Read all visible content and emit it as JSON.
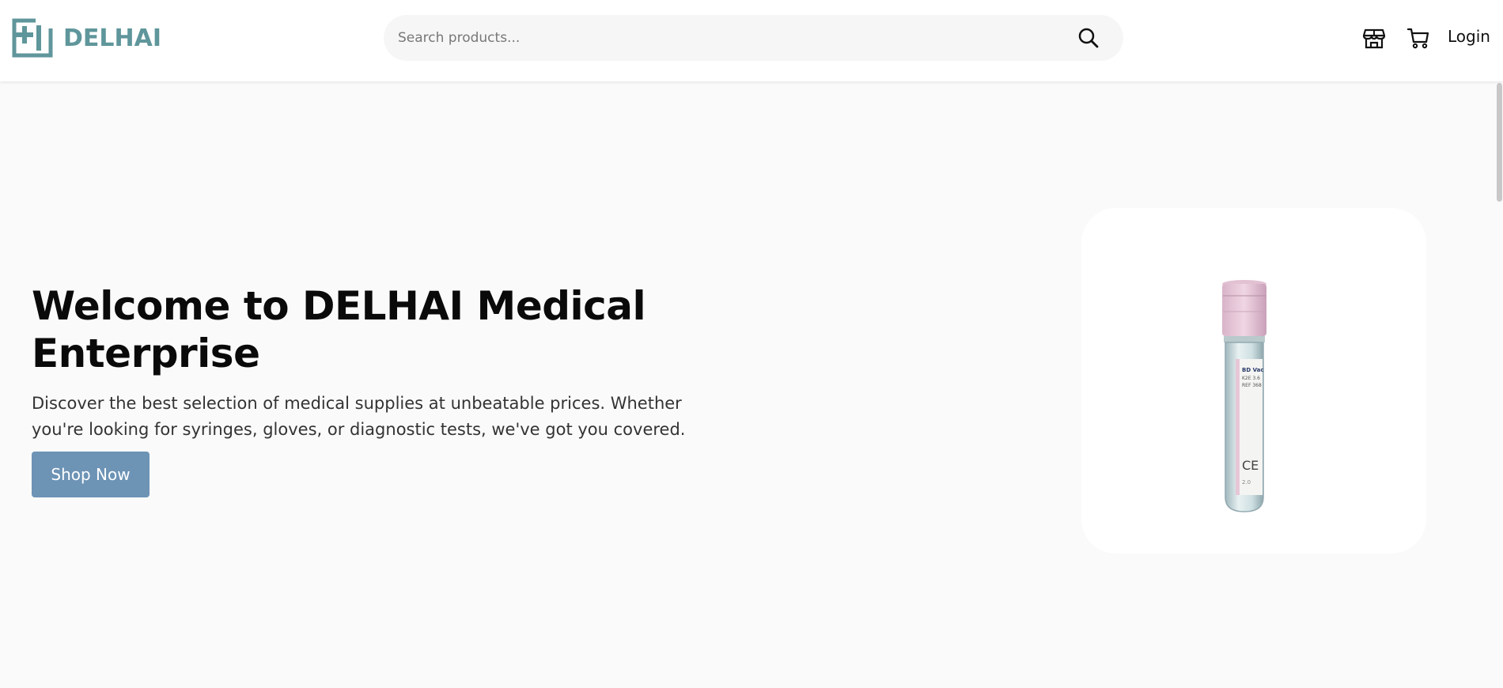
{
  "header": {
    "brand": "DELHAI",
    "search": {
      "placeholder": "Search products...",
      "value": ""
    },
    "icons": [
      "store-icon",
      "cart-icon",
      "search-icon"
    ],
    "login_label": "Login"
  },
  "hero": {
    "title": "Welcome to DELHAI Medical Enterprise",
    "description": "Discover the best selection of medical supplies at unbeatable prices. Whether you're looking for syringes, gloves, or diagnostic tests, we've got you covered.",
    "cta_label": "Shop Now",
    "product_image": "blood-collection-tube"
  },
  "colors": {
    "brand": "#5f969b",
    "button": "#6d93b5",
    "page_background": "#fafafa",
    "tube_cap": "#e9c9dc"
  }
}
